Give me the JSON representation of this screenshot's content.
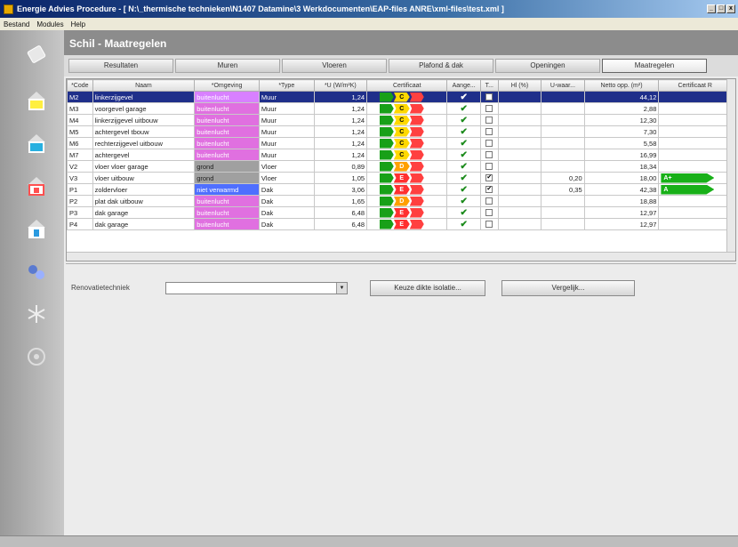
{
  "window": {
    "title": "Energie Advies Procedure - [ N:\\_thermische technieken\\N1407 Datamine\\3 Werkdocumenten\\EAP-files ANRE\\xml-files\\test.xml ]",
    "min": "_",
    "max": "□",
    "close": "x"
  },
  "menu": [
    "Bestand",
    "Modules",
    "Help"
  ],
  "header": {
    "title": "Schil - Maatregelen"
  },
  "tabs": [
    "Resultaten",
    "Muren",
    "Vloeren",
    "Plafond & dak",
    "Openingen",
    "Maatregelen"
  ],
  "grid": {
    "columns": [
      "*Code",
      "Naam",
      "*Omgeving",
      "*Type",
      "*U (W/m²K)",
      "Certificaat",
      "Aange...",
      "T...",
      "Hl (%)",
      "U-waar...",
      "Netto opp. (m²)",
      "Certificaat R"
    ],
    "rows": [
      {
        "code": "M2",
        "naam": "linkerzijgevel",
        "omgeving": "buitenlucht",
        "type": "Muur",
        "u": "1,24",
        "cert": "C",
        "aange": "✔",
        "t": "",
        "hl": "",
        "uw": "",
        "netto": "44,12",
        "certr": ""
      },
      {
        "code": "M3",
        "naam": "voorgevel garage",
        "omgeving": "buitenlucht",
        "type": "Muur",
        "u": "1,24",
        "cert": "C",
        "aange": "✔",
        "t": "",
        "hl": "",
        "uw": "",
        "netto": "2,88",
        "certr": ""
      },
      {
        "code": "M4",
        "naam": "linkerzijgevel uitbouw",
        "omgeving": "buitenlucht",
        "type": "Muur",
        "u": "1,24",
        "cert": "C",
        "aange": "✔",
        "t": "",
        "hl": "",
        "uw": "",
        "netto": "12,30",
        "certr": ""
      },
      {
        "code": "M5",
        "naam": "achtergevel tbouw",
        "omgeving": "buitenlucht",
        "type": "Muur",
        "u": "1,24",
        "cert": "C",
        "aange": "✔",
        "t": "",
        "hl": "",
        "uw": "",
        "netto": "7,30",
        "certr": ""
      },
      {
        "code": "M6",
        "naam": "rechterzijgevel uitbouw",
        "omgeving": "buitenlucht",
        "type": "Muur",
        "u": "1,24",
        "cert": "C",
        "aange": "✔",
        "t": "",
        "hl": "",
        "uw": "",
        "netto": "5,58",
        "certr": ""
      },
      {
        "code": "M7",
        "naam": "achtergevel",
        "omgeving": "buitenlucht",
        "type": "Muur",
        "u": "1,24",
        "cert": "C",
        "aange": "✔",
        "t": "",
        "hl": "",
        "uw": "",
        "netto": "16,99",
        "certr": ""
      },
      {
        "code": "V2",
        "naam": "vloer vloer garage",
        "omgeving": "grond",
        "type": "Vloer",
        "u": "0,89",
        "cert": "D",
        "aange": "✔",
        "t": "",
        "hl": "",
        "uw": "",
        "netto": "18,34",
        "certr": ""
      },
      {
        "code": "V3",
        "naam": "vloer uitbouw",
        "omgeving": "grond",
        "type": "Vloer",
        "u": "1,05",
        "cert": "E",
        "aange": "✔",
        "t": "✔",
        "hl": "",
        "uw": "0,20",
        "netto": "18,00",
        "certr": "A+"
      },
      {
        "code": "P1",
        "naam": "zoldervloer",
        "omgeving": "niet verwarmd",
        "type": "Dak",
        "u": "3,06",
        "cert": "E",
        "aange": "✔",
        "t": "✔",
        "hl": "",
        "uw": "0,35",
        "netto": "42,38",
        "certr": "A"
      },
      {
        "code": "P2",
        "naam": "plat dak uitbouw",
        "omgeving": "buitenlucht",
        "type": "Dak",
        "u": "1,65",
        "cert": "D",
        "aange": "✔",
        "t": "",
        "hl": "",
        "uw": "",
        "netto": "18,88",
        "certr": ""
      },
      {
        "code": "P3",
        "naam": "dak garage",
        "omgeving": "buitenlucht",
        "type": "Dak",
        "u": "6,48",
        "cert": "E",
        "aange": "✔",
        "t": "",
        "hl": "",
        "uw": "",
        "netto": "12,97",
        "certr": ""
      },
      {
        "code": "P4",
        "naam": "dak garage",
        "omgeving": "buitenlucht",
        "type": "Dak",
        "u": "6,48",
        "cert": "E",
        "aange": "✔",
        "t": "",
        "hl": "",
        "uw": "",
        "netto": "12,97",
        "certr": ""
      }
    ]
  },
  "lower": {
    "reno_label": "Renovatietechniek",
    "reno_value": "",
    "keuze_button": "Keuze dikte isolatie...",
    "vergelijk_button": "Vergelijk..."
  },
  "sidebar_icons": [
    "notebook-icon",
    "house-yellow-icon",
    "house-blue-icon",
    "house-red-icon",
    "house-blue2-icon",
    "tools-icon",
    "snowflake-icon",
    "fan-icon"
  ]
}
